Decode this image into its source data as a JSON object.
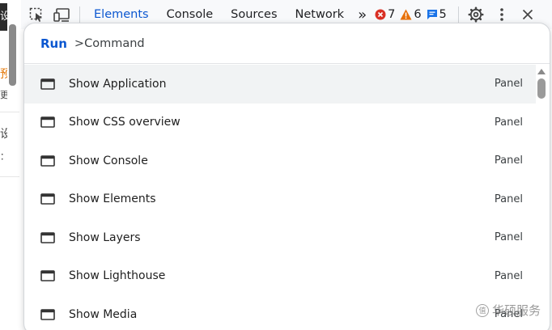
{
  "page_strip": {
    "chip_char": "设",
    "fragments": [
      "预",
      "更",
      "设",
      "：",
      "设"
    ]
  },
  "toolbar": {
    "tabs": [
      {
        "label": "Elements",
        "active": true
      },
      {
        "label": "Console",
        "active": false
      },
      {
        "label": "Sources",
        "active": false
      },
      {
        "label": "Network",
        "active": false
      }
    ],
    "more_tabs": "»",
    "errors": "7",
    "warnings": "6",
    "messages": "5",
    "colors": {
      "error": "#d93025",
      "warning": "#e8710a",
      "message": "#1a73e8",
      "accent": "#0b57d0"
    }
  },
  "palette": {
    "run_label": "Run",
    "input_value": ">Command",
    "items": [
      {
        "label": "Show Application",
        "category": "Panel",
        "selected": true
      },
      {
        "label": "Show CSS overview",
        "category": "Panel",
        "selected": false
      },
      {
        "label": "Show Console",
        "category": "Panel",
        "selected": false
      },
      {
        "label": "Show Elements",
        "category": "Panel",
        "selected": false
      },
      {
        "label": "Show Layers",
        "category": "Panel",
        "selected": false
      },
      {
        "label": "Show Lighthouse",
        "category": "Panel",
        "selected": false
      },
      {
        "label": "Show Media",
        "category": "Panel",
        "selected": false
      }
    ]
  },
  "watermark": {
    "logo_text": "值",
    "text": "华硕服务"
  }
}
